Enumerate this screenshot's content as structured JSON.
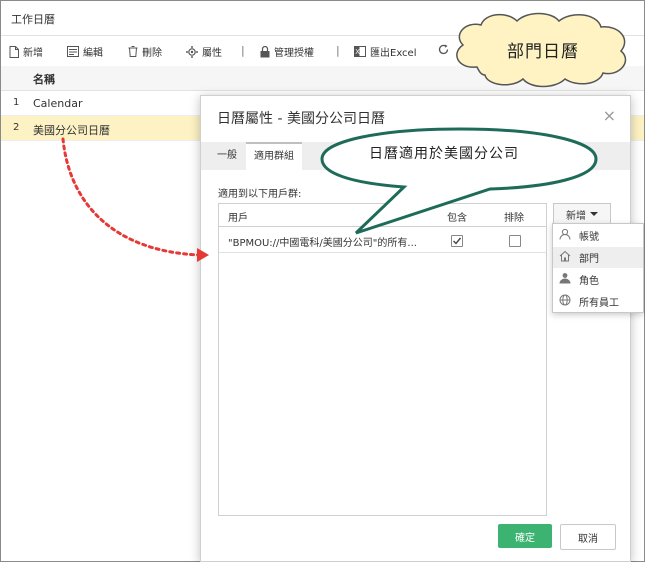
{
  "app": {
    "title": "工作日曆"
  },
  "toolbar": {
    "new": "新增",
    "edit": "編輯",
    "delete": "刪除",
    "properties": "屬性",
    "separator": "|",
    "manage_auth": "管理授權",
    "export": "匯出Excel"
  },
  "grid": {
    "column_header": "名稱",
    "rows": [
      {
        "num": "1",
        "name": "Calendar"
      },
      {
        "num": "2",
        "name": "美國分公司日曆"
      }
    ]
  },
  "dialog": {
    "title": "日曆屬性 - 美國分公司日曆",
    "close": "×",
    "tabs": [
      "一般",
      "適用群組"
    ],
    "section_label": "適用到以下用戶群:",
    "table": {
      "headers": {
        "user": "用戶",
        "include": "包含",
        "exclude": "排除"
      },
      "rows": [
        {
          "user": "\"BPMOU://中國電科/美國分公司\"的所有...",
          "include": true,
          "exclude": false
        }
      ]
    },
    "add_button": "新增",
    "ok_button": "確定",
    "cancel_button": "取消"
  },
  "dropdown": {
    "items": [
      {
        "label": "帳號",
        "icon": "user-icon"
      },
      {
        "label": "部門",
        "icon": "home-icon"
      },
      {
        "label": "角色",
        "icon": "role-icon"
      },
      {
        "label": "所有員工",
        "icon": "globe-icon"
      }
    ],
    "highlighted_index": 1
  },
  "callouts": {
    "cloud": "部門日曆",
    "bubble": "日曆適用於美國分公司"
  },
  "colors": {
    "selected_row": "#fdf2c4",
    "ok_button": "#3cb371",
    "arrow": "#e53935",
    "cloud_fill": "#fff3c4",
    "bubble_border": "#1f6b5a"
  }
}
